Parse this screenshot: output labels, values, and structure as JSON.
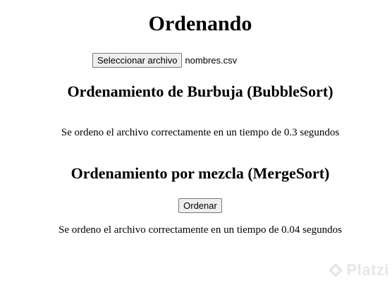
{
  "page": {
    "title": "Ordenando"
  },
  "upload": {
    "button_label": "Seleccionar archivo",
    "file_name": "nombres.csv"
  },
  "bubble_sort": {
    "heading": "Ordenamiento de Burbuja (BubbleSort)",
    "result": "Se ordeno el archivo correctamente en un tiempo de 0.3 segundos"
  },
  "merge_sort": {
    "heading": "Ordenamiento por mezcla (MergeSort)",
    "button_label": "Ordenar",
    "result": "Se ordeno el archivo correctamente en un tiempo de 0.04 segundos"
  },
  "watermark": {
    "text": "Platzi",
    "icon": "platzi-logo-icon",
    "color": "#e6e6e6"
  }
}
